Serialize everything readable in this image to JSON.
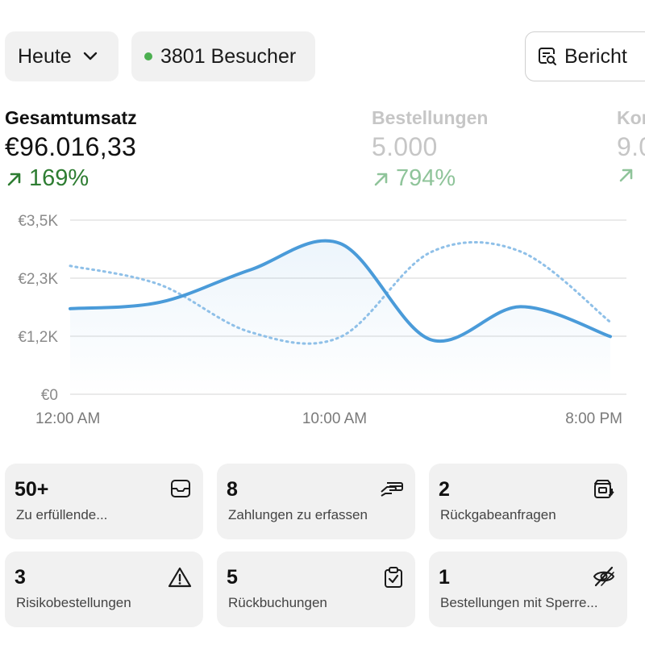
{
  "toolbar": {
    "period_label": "Heute",
    "visitors_label": "3801 Besucher",
    "report_label": "Bericht"
  },
  "metrics": [
    {
      "label": "Gesamtumsatz",
      "value": "€96.016,33",
      "change": "169%"
    },
    {
      "label": "Bestellungen",
      "value": "5.000",
      "change": "794%"
    },
    {
      "label": "Kon",
      "value": "9.0",
      "change": ""
    }
  ],
  "chart_data": {
    "type": "line",
    "x_ticks": [
      "12:00 AM",
      "10:00 AM",
      "8:00 PM"
    ],
    "y_ticks": [
      "€0",
      "€1,2K",
      "€2,3K",
      "€3,5K"
    ],
    "ylim": [
      0,
      3500
    ],
    "x": [
      0,
      4,
      8,
      12,
      16,
      20,
      24
    ],
    "series": [
      {
        "values": [
          1720,
          1850,
          2500,
          3030,
          1100,
          1760,
          1160
        ]
      },
      {
        "values": [
          2580,
          2200,
          1250,
          1150,
          2850,
          2870,
          1450
        ]
      }
    ],
    "colors": {
      "current": "#4a9bd9",
      "previous": "#8fc0e8"
    }
  },
  "cards": [
    {
      "count": "50+",
      "desc": "Zu erfüllende...",
      "icon": "inbox-icon"
    },
    {
      "count": "8",
      "desc": "Zahlungen zu erfassen",
      "icon": "hand-card-icon"
    },
    {
      "count": "2",
      "desc": "Rückgabeanfragen",
      "icon": "return-box-icon"
    },
    {
      "count": "3",
      "desc": "Risikobestellungen",
      "icon": "warning-icon"
    },
    {
      "count": "5",
      "desc": "Rückbuchungen",
      "icon": "clipboard-check-icon"
    },
    {
      "count": "1",
      "desc": "Bestellungen mit Sperre...",
      "icon": "eye-off-icon"
    }
  ]
}
